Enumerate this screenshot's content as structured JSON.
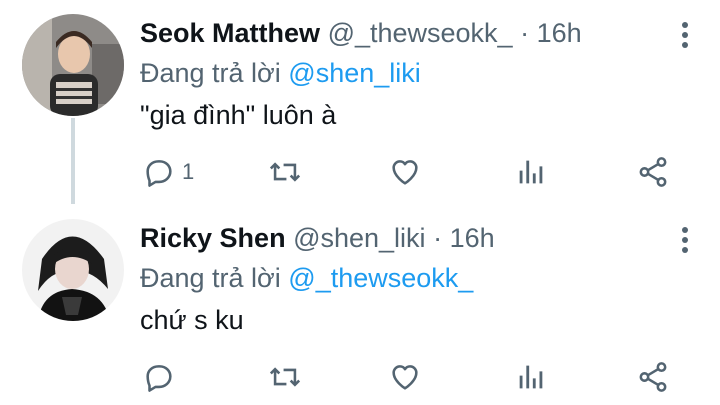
{
  "tweets": [
    {
      "name": "Seok Matthew",
      "handle": "@_thewseokk_",
      "dot": "·",
      "time": "16h",
      "replying_prefix": "Đang trả lời",
      "replying_to": "@shen_liki",
      "text": "\"gia đình\" luôn à",
      "reply_count": "1",
      "avatar_icon": "profile-photo"
    },
    {
      "name": "Ricky Shen",
      "handle": "@shen_liki",
      "dot": "·",
      "time": "16h",
      "replying_prefix": "Đang trả lời",
      "replying_to": "@_thewseokk_",
      "text": "chứ s ku",
      "reply_count": "",
      "avatar_icon": "profile-photo"
    }
  ],
  "colors": {
    "link": "#1d9bf0",
    "secondary": "#536471",
    "thread_line": "#cfd9de"
  },
  "icons": [
    "reply-icon",
    "retweet-icon",
    "like-icon",
    "analytics-icon",
    "share-icon",
    "more-icon"
  ]
}
